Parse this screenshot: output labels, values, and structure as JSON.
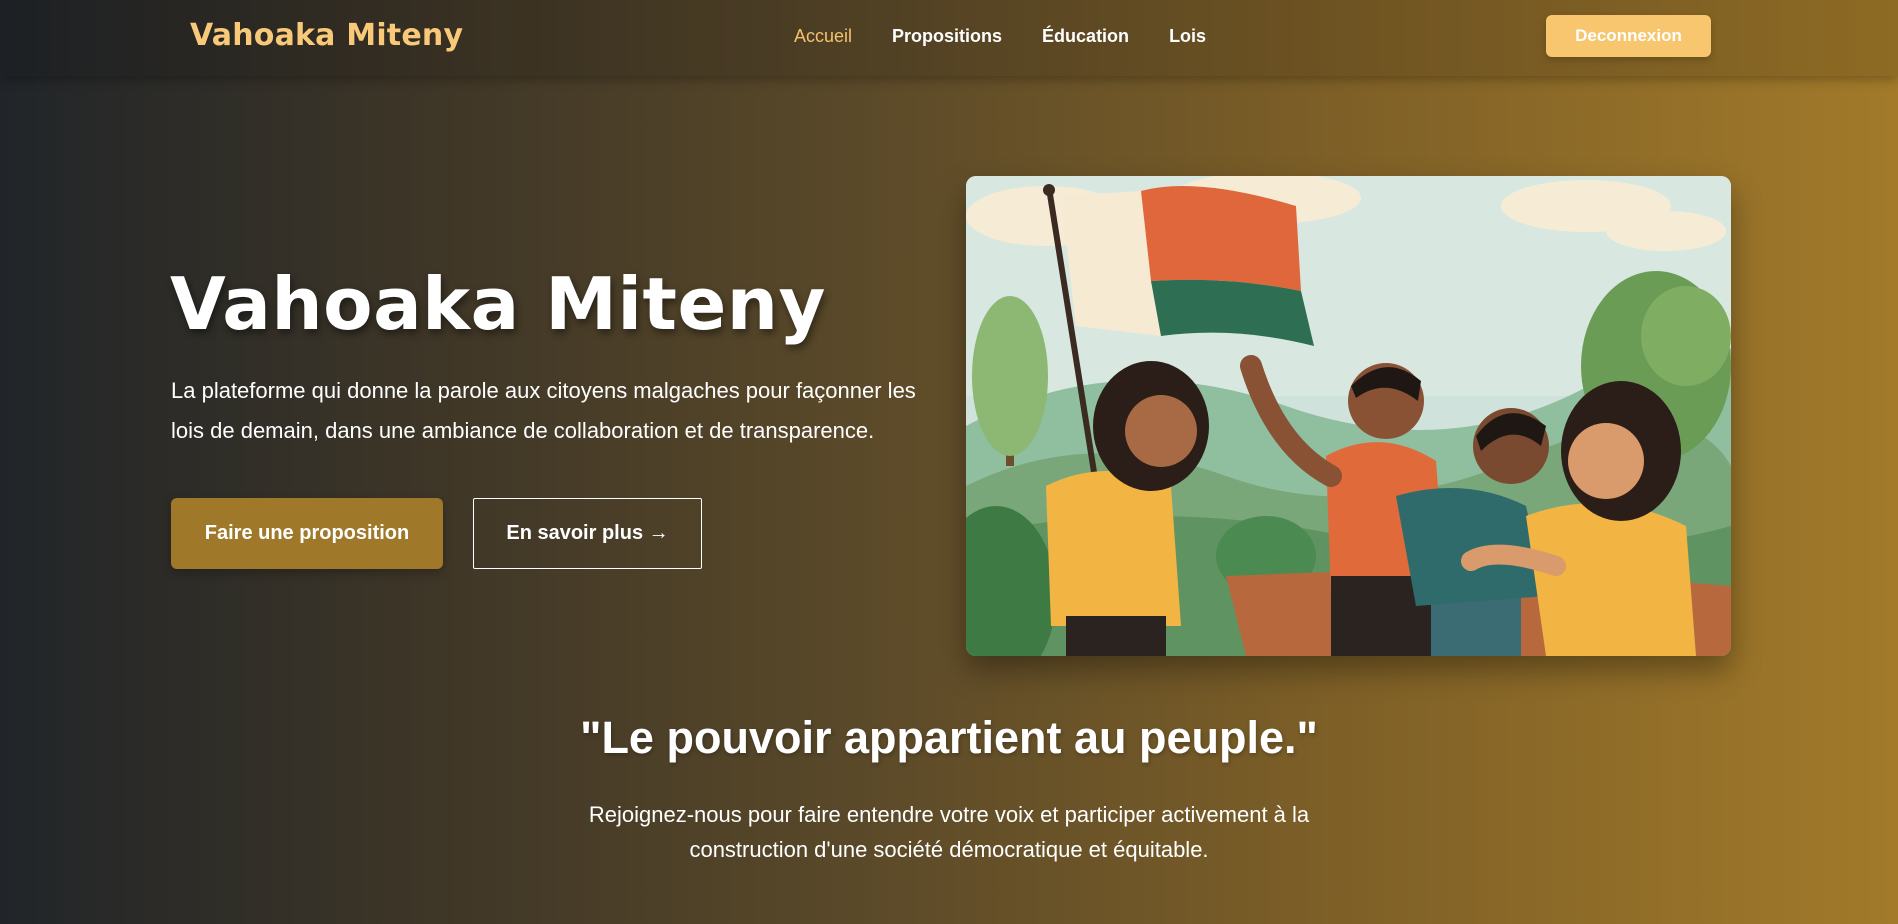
{
  "brand": {
    "name": "Vahoaka Miteny",
    "color": "#f9c97a"
  },
  "nav": {
    "items": [
      {
        "label": "Accueil",
        "active": true
      },
      {
        "label": "Propositions",
        "active": false
      },
      {
        "label": "Éducation",
        "active": false
      },
      {
        "label": "Lois",
        "active": false
      }
    ],
    "logout_label": "Deconnexion"
  },
  "hero": {
    "title": "Vahoaka Miteny",
    "description": "La plateforme qui donne la parole aux citoyens malgaches pour façonner les lois de demain, dans une ambiance de collaboration et de transparence.",
    "primary_button": "Faire une proposition",
    "secondary_button": "En savoir plus →",
    "image": "illustration of citizens with Madagascar flag casting ballot"
  },
  "quote": {
    "text": "\"Le pouvoir appartient au peuple.\"",
    "subtext": "Rejoignez-nous pour faire entendre votre voix et participer activement à la construction d'une société démocratique et équitable."
  },
  "colors": {
    "accent": "#f4c16e",
    "button_primary": "#a0782a",
    "button_logout": "#f7c66f",
    "gradient_start": "#212529",
    "gradient_end": "#a27a2a"
  }
}
